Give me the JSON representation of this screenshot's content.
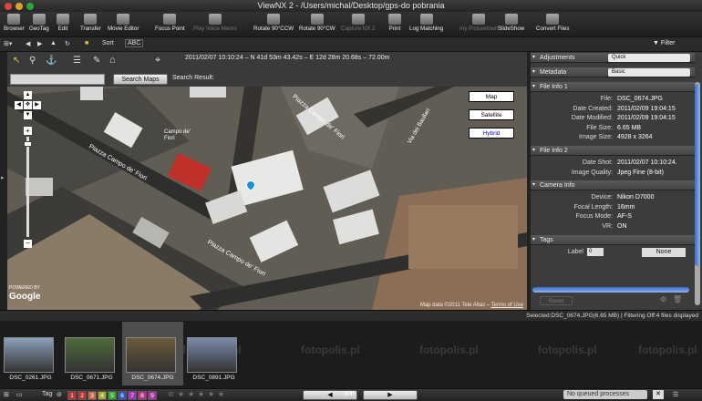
{
  "window": {
    "title": "ViewNX 2 - /Users/michal/Desktop/gps-do pobrania"
  },
  "toolbar": {
    "items": [
      {
        "label": "Browser",
        "icon": "browser-icon"
      },
      {
        "label": "GeoTag",
        "icon": "geotag-icon"
      },
      {
        "label": "Edit",
        "icon": "edit-icon"
      },
      {
        "label": "Transfer",
        "icon": "camera-icon"
      },
      {
        "label": "Movie Editor",
        "icon": "movie-editor-icon"
      },
      {
        "label": "Focus Point",
        "icon": "focus-point-icon"
      },
      {
        "label": "Play Voice Memo",
        "icon": "play-voice-memo-icon"
      },
      {
        "label": "Rotate 90°CCW",
        "icon": "rotate-ccw-icon"
      },
      {
        "label": "Rotate 90°CW",
        "icon": "rotate-cw-icon"
      },
      {
        "label": "Capture NX 2",
        "icon": "capture-nx2-icon"
      },
      {
        "label": "Print",
        "icon": "print-icon"
      },
      {
        "label": "Log Matching",
        "icon": "log-matching-icon"
      },
      {
        "label": "my Picturetown",
        "icon": "picturetown-icon"
      },
      {
        "label": "SlideShow",
        "icon": "slideshow-icon"
      },
      {
        "label": "Convert Files",
        "icon": "convert-files-icon"
      }
    ]
  },
  "subtoolbar": {
    "sort_label": "Sort",
    "sort_value": "ABC",
    "filter_label": "Filter"
  },
  "map": {
    "coordinates": "2011/02/07 10:10:24 – N 41d 53m 43.42s – E 12d 28m 20.68s – 72.00m",
    "search_button": "Search Maps",
    "search_result_label": "Search Result:",
    "search_value": "",
    "type_buttons": [
      "Map",
      "Satellite",
      "Hybrid"
    ],
    "street_labels": [
      "Piazza Campo de' Fiori",
      "Piazza Campo de' Fiori",
      "Piazza Campo de' Fiori",
      "Via dei Baullari",
      "Campo de' Fiori"
    ],
    "copyright": "Map data ©2011 Tele Atlas",
    "terms": "Terms of Use",
    "powered_by": "POWERED BY",
    "logo": "Google"
  },
  "right_panel": {
    "adjustments_label": "Adjustments",
    "adjustments_value": "Quick",
    "metadata_label": "Metadata",
    "metadata_value": "Basic",
    "sections": [
      {
        "title": "File Info 1",
        "rows": [
          {
            "key": "File:",
            "value": "DSC_0674.JPG"
          },
          {
            "key": "Date Created:",
            "value": "2011/02/09 19:04:15"
          },
          {
            "key": "Date Modified:",
            "value": "2011/02/09 19:04:15"
          },
          {
            "key": "File Size:",
            "value": "6.65 MB"
          },
          {
            "key": "Image Size:",
            "value": "4928 x 3264"
          }
        ]
      },
      {
        "title": "File Info 2",
        "rows": [
          {
            "key": "Date Shot:",
            "value": "2011/02/07 10:10:24."
          },
          {
            "key": "Image Quality:",
            "value": "Jpeg Fine (8-bit)"
          }
        ]
      },
      {
        "title": "Camera Info",
        "rows": [
          {
            "key": "Device:",
            "value": "Nikon D7000"
          },
          {
            "key": "Focal Length:",
            "value": "16mm"
          },
          {
            "key": "Focus Mode:",
            "value": "AF-S"
          },
          {
            "key": "VR:",
            "value": "ON"
          }
        ]
      },
      {
        "title": "Tags",
        "rows": [
          {
            "key": "Label",
            "value": "None"
          }
        ]
      }
    ],
    "reset_label": "Reset",
    "label_select": "0"
  },
  "status": {
    "text": "Selected:DSC_0674.JPG(6.65 MB) | Filtering Off:4 files displayed"
  },
  "thumbnails": [
    {
      "name": "DSC_0261.JPG",
      "selected": false,
      "color": "#8aa0b8"
    },
    {
      "name": "DSC_0671.JPG",
      "selected": false,
      "color": "#4e6a3a"
    },
    {
      "name": "DSC_0674.JPG",
      "selected": true,
      "color": "#6b5a3a"
    },
    {
      "name": "DSC_0891.JPG",
      "selected": false,
      "color": "#7a8aa8"
    }
  ],
  "watermark": "fotopolis.pl",
  "bottom": {
    "tag_label": "Tag",
    "tag_numbers": [
      "1",
      "2",
      "3",
      "4",
      "5",
      "6",
      "7",
      "8",
      "9"
    ],
    "tag_colors": [
      "#b33",
      "#b33",
      "#c64",
      "#aa3",
      "#3a3",
      "#35b",
      "#a3b",
      "#b38",
      "#a3a"
    ],
    "page_indicator": "3/4",
    "queue": "No queued processes"
  }
}
